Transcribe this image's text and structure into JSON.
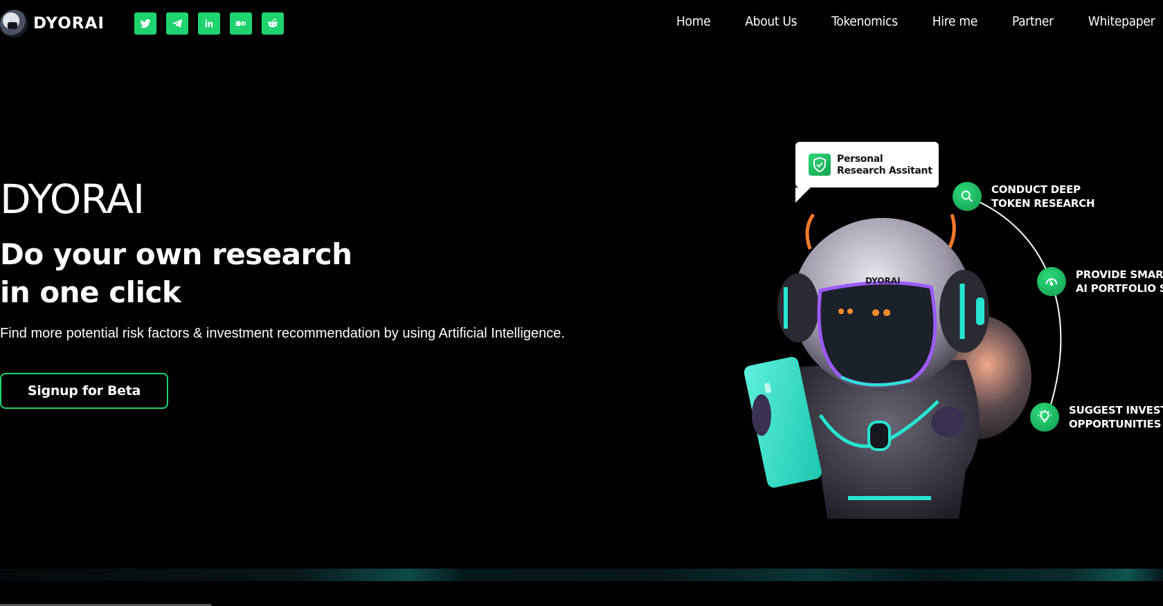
{
  "header": {
    "logo_text": "DYORAI",
    "socials": [
      {
        "name": "twitter-icon",
        "label": "Twitter"
      },
      {
        "name": "telegram-icon",
        "label": "Telegram"
      },
      {
        "name": "linkedin-icon",
        "label": "in"
      },
      {
        "name": "medium-icon",
        "label": "Medium"
      },
      {
        "name": "reddit-icon",
        "label": "Reddit"
      }
    ],
    "nav": [
      "Home",
      "About Us",
      "Tokenomics",
      "Hire me",
      "Partner",
      "Whitepaper"
    ]
  },
  "hero": {
    "title": "DYORAI",
    "subtitle_line1": "Do your own research",
    "subtitle_line2": "in one click",
    "description": "Find more potential risk factors & investment recommendation by using Artificial Intelligence.",
    "cta_label": "Signup for Beta"
  },
  "illustration": {
    "bubble_line1": "Personal",
    "bubble_line2": "Research Assitant",
    "robot_badge": "DYORAI",
    "features": [
      {
        "icon": "search-icon",
        "line1": "CONDUCT DEEP",
        "line2": "TOKEN RESEARCH"
      },
      {
        "icon": "gauge-icon",
        "line1": "PROVIDE SMART",
        "line2": "AI PORTFOLIO SCORE"
      },
      {
        "icon": "lightbulb-icon",
        "line1": "SUGGEST INVESTMENT",
        "line2": "OPPORTUNITIES"
      }
    ]
  },
  "colors": {
    "accent": "#1fd46f",
    "background": "#000000",
    "cyan": "#27e5d0",
    "orange": "#ff7a2b"
  }
}
